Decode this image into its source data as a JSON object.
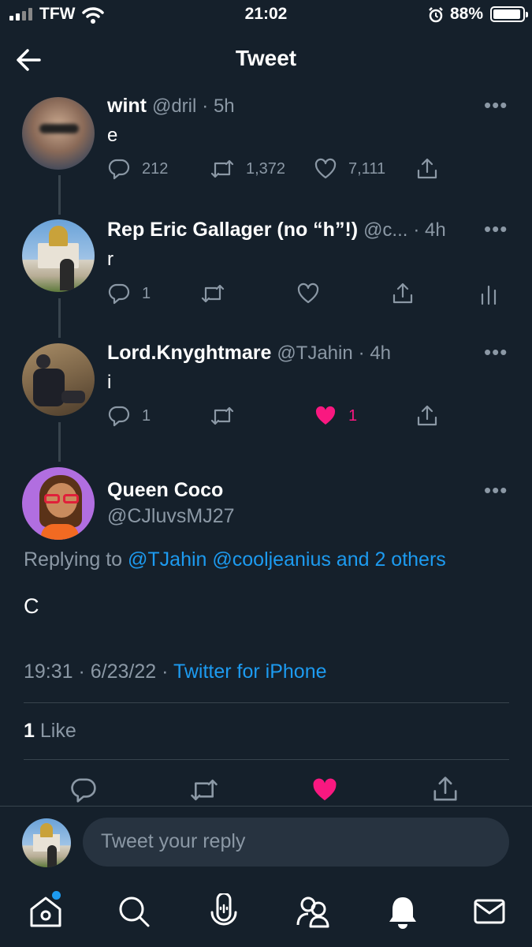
{
  "status_bar": {
    "carrier": "TFW",
    "time": "21:02",
    "battery": "88%"
  },
  "header": {
    "title": "Tweet"
  },
  "thread": [
    {
      "name": "wint",
      "handle": "@dril",
      "time": "· 5h",
      "text": "e",
      "replies": "212",
      "retweets": "1,372",
      "likes": "7,111",
      "liked": false
    },
    {
      "name": "Rep Eric Gallager (no “h”!)",
      "handle": "@c...",
      "time": "· 4h",
      "text": "r",
      "replies": "1",
      "retweets": "",
      "likes": "",
      "liked": false
    },
    {
      "name": "Lord.Knyghtmare",
      "handle": "@TJahin",
      "time": "· 4h",
      "text": "i",
      "replies": "1",
      "retweets": "",
      "likes": "1",
      "liked": true
    }
  ],
  "main_tweet": {
    "name": "Queen Coco",
    "handle": "@CJluvsMJ27",
    "replying_prefix": "Replying to",
    "replying_to": "@TJahin @cooljeanius and 2 others",
    "text": "C",
    "timestamp": "19:31 · 6/23/22 ·",
    "source": "Twitter for iPhone",
    "likes_count": "1",
    "likes_label": "Like"
  },
  "reply_bar": {
    "placeholder": "Tweet your reply"
  },
  "tab_bar": [
    "home-icon",
    "search-icon",
    "spaces-icon",
    "communities-icon",
    "notifications-icon",
    "messages-icon"
  ],
  "colors": {
    "background": "#15202b",
    "accent": "#1d9bf0",
    "like": "#f91880",
    "muted": "#8b98a5"
  }
}
